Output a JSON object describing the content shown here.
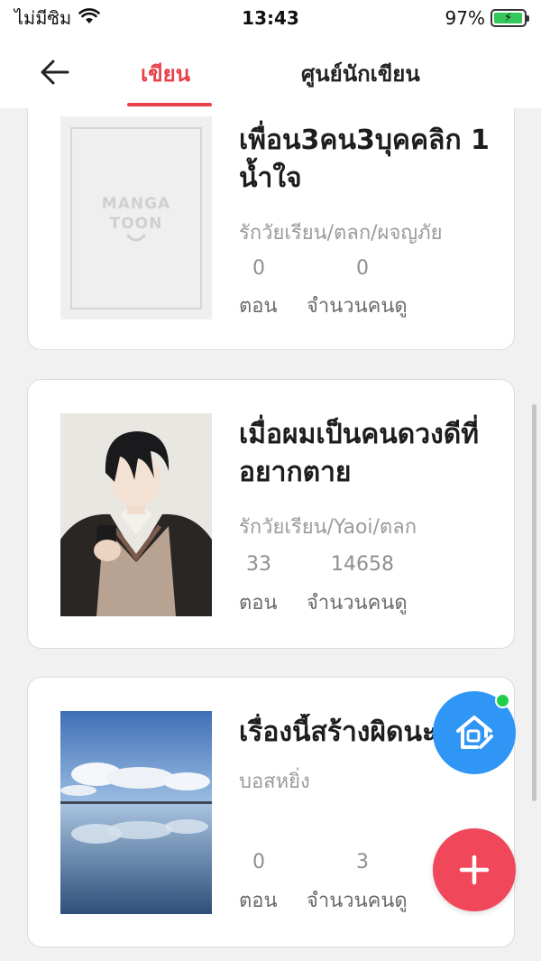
{
  "status": {
    "carrier": "ไม่มีซิม",
    "time": "13:43",
    "battery": "97%",
    "battery_level": 0.97,
    "wifi_icon": "wifi-icon"
  },
  "header": {
    "back_icon": "arrow-left-icon",
    "tabs": [
      {
        "label": "เขียน",
        "active": true
      },
      {
        "label": "ศูนย์นักเขียน",
        "active": false
      }
    ],
    "accent_color": "#e8414a"
  },
  "placeholder_logo": {
    "line1": "MANGA",
    "line2": "TOON"
  },
  "works": [
    {
      "title": "เพื่อน3คน3บุคคลิก 1 น้ำใจ",
      "genre": "รักวัยเรียน/ตลก/ผจญภัย",
      "episodes": "0",
      "views": "0",
      "episodes_label": "ตอน",
      "views_label": "จำนวนคนดู",
      "cover": "placeholder"
    },
    {
      "title": "เมื่อผมเป็นคนดวงดีที่อยากตาย",
      "genre": "รักวัยเรียน/Yaoi/ตลก",
      "episodes": "33",
      "views": "14658",
      "episodes_label": "ตอน",
      "views_label": "จำนวนคนดู",
      "cover": "anime-boy-illustration"
    },
    {
      "title": "เรื่องนี้สร้างผิดนะ",
      "genre": "บอสหยิ่ง",
      "episodes": "0",
      "views": "3",
      "episodes_label": "ตอน",
      "views_label": "จำนวนคนดู",
      "cover": "sky-lake-photo"
    }
  ],
  "fabs": {
    "home_icon": "writer-home-icon",
    "home_color": "#2f96f5",
    "notification_dot_color": "#1fcf4b",
    "add_icon": "plus-icon",
    "add_color": "#f0485a"
  }
}
